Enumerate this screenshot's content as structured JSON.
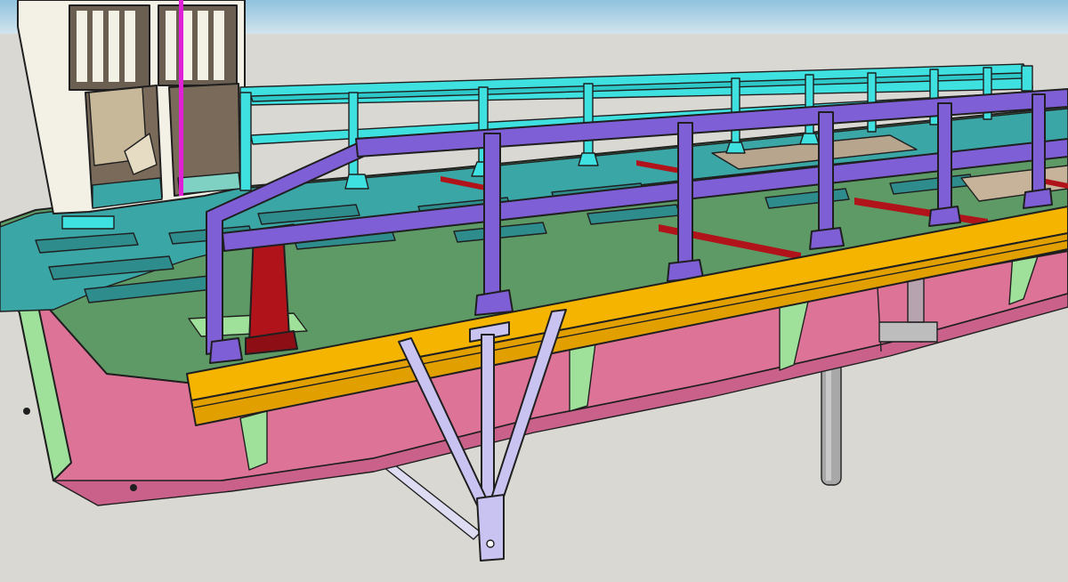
{
  "scene": {
    "colors": {
      "sky": "#a9cfe3",
      "ground": "#d9d8d3",
      "cabin_white": "#f3f1e6",
      "cabin_dark": "#7a6a5a",
      "deck_green": "#5e9a66",
      "deck_cyan": "#3aa6a6",
      "hull_pink": "#de7398",
      "frame_green": "#9fe19a",
      "rail_cyan": "#3fe0e0",
      "rail_purple": "#7f5fd6",
      "beam_yellow": "#f5b400",
      "bracket_lilac": "#c9c3f2",
      "post_red": "#b0141a",
      "pole_gray": "#a8a8a8",
      "mast_magenta": "#e21fd8"
    }
  }
}
